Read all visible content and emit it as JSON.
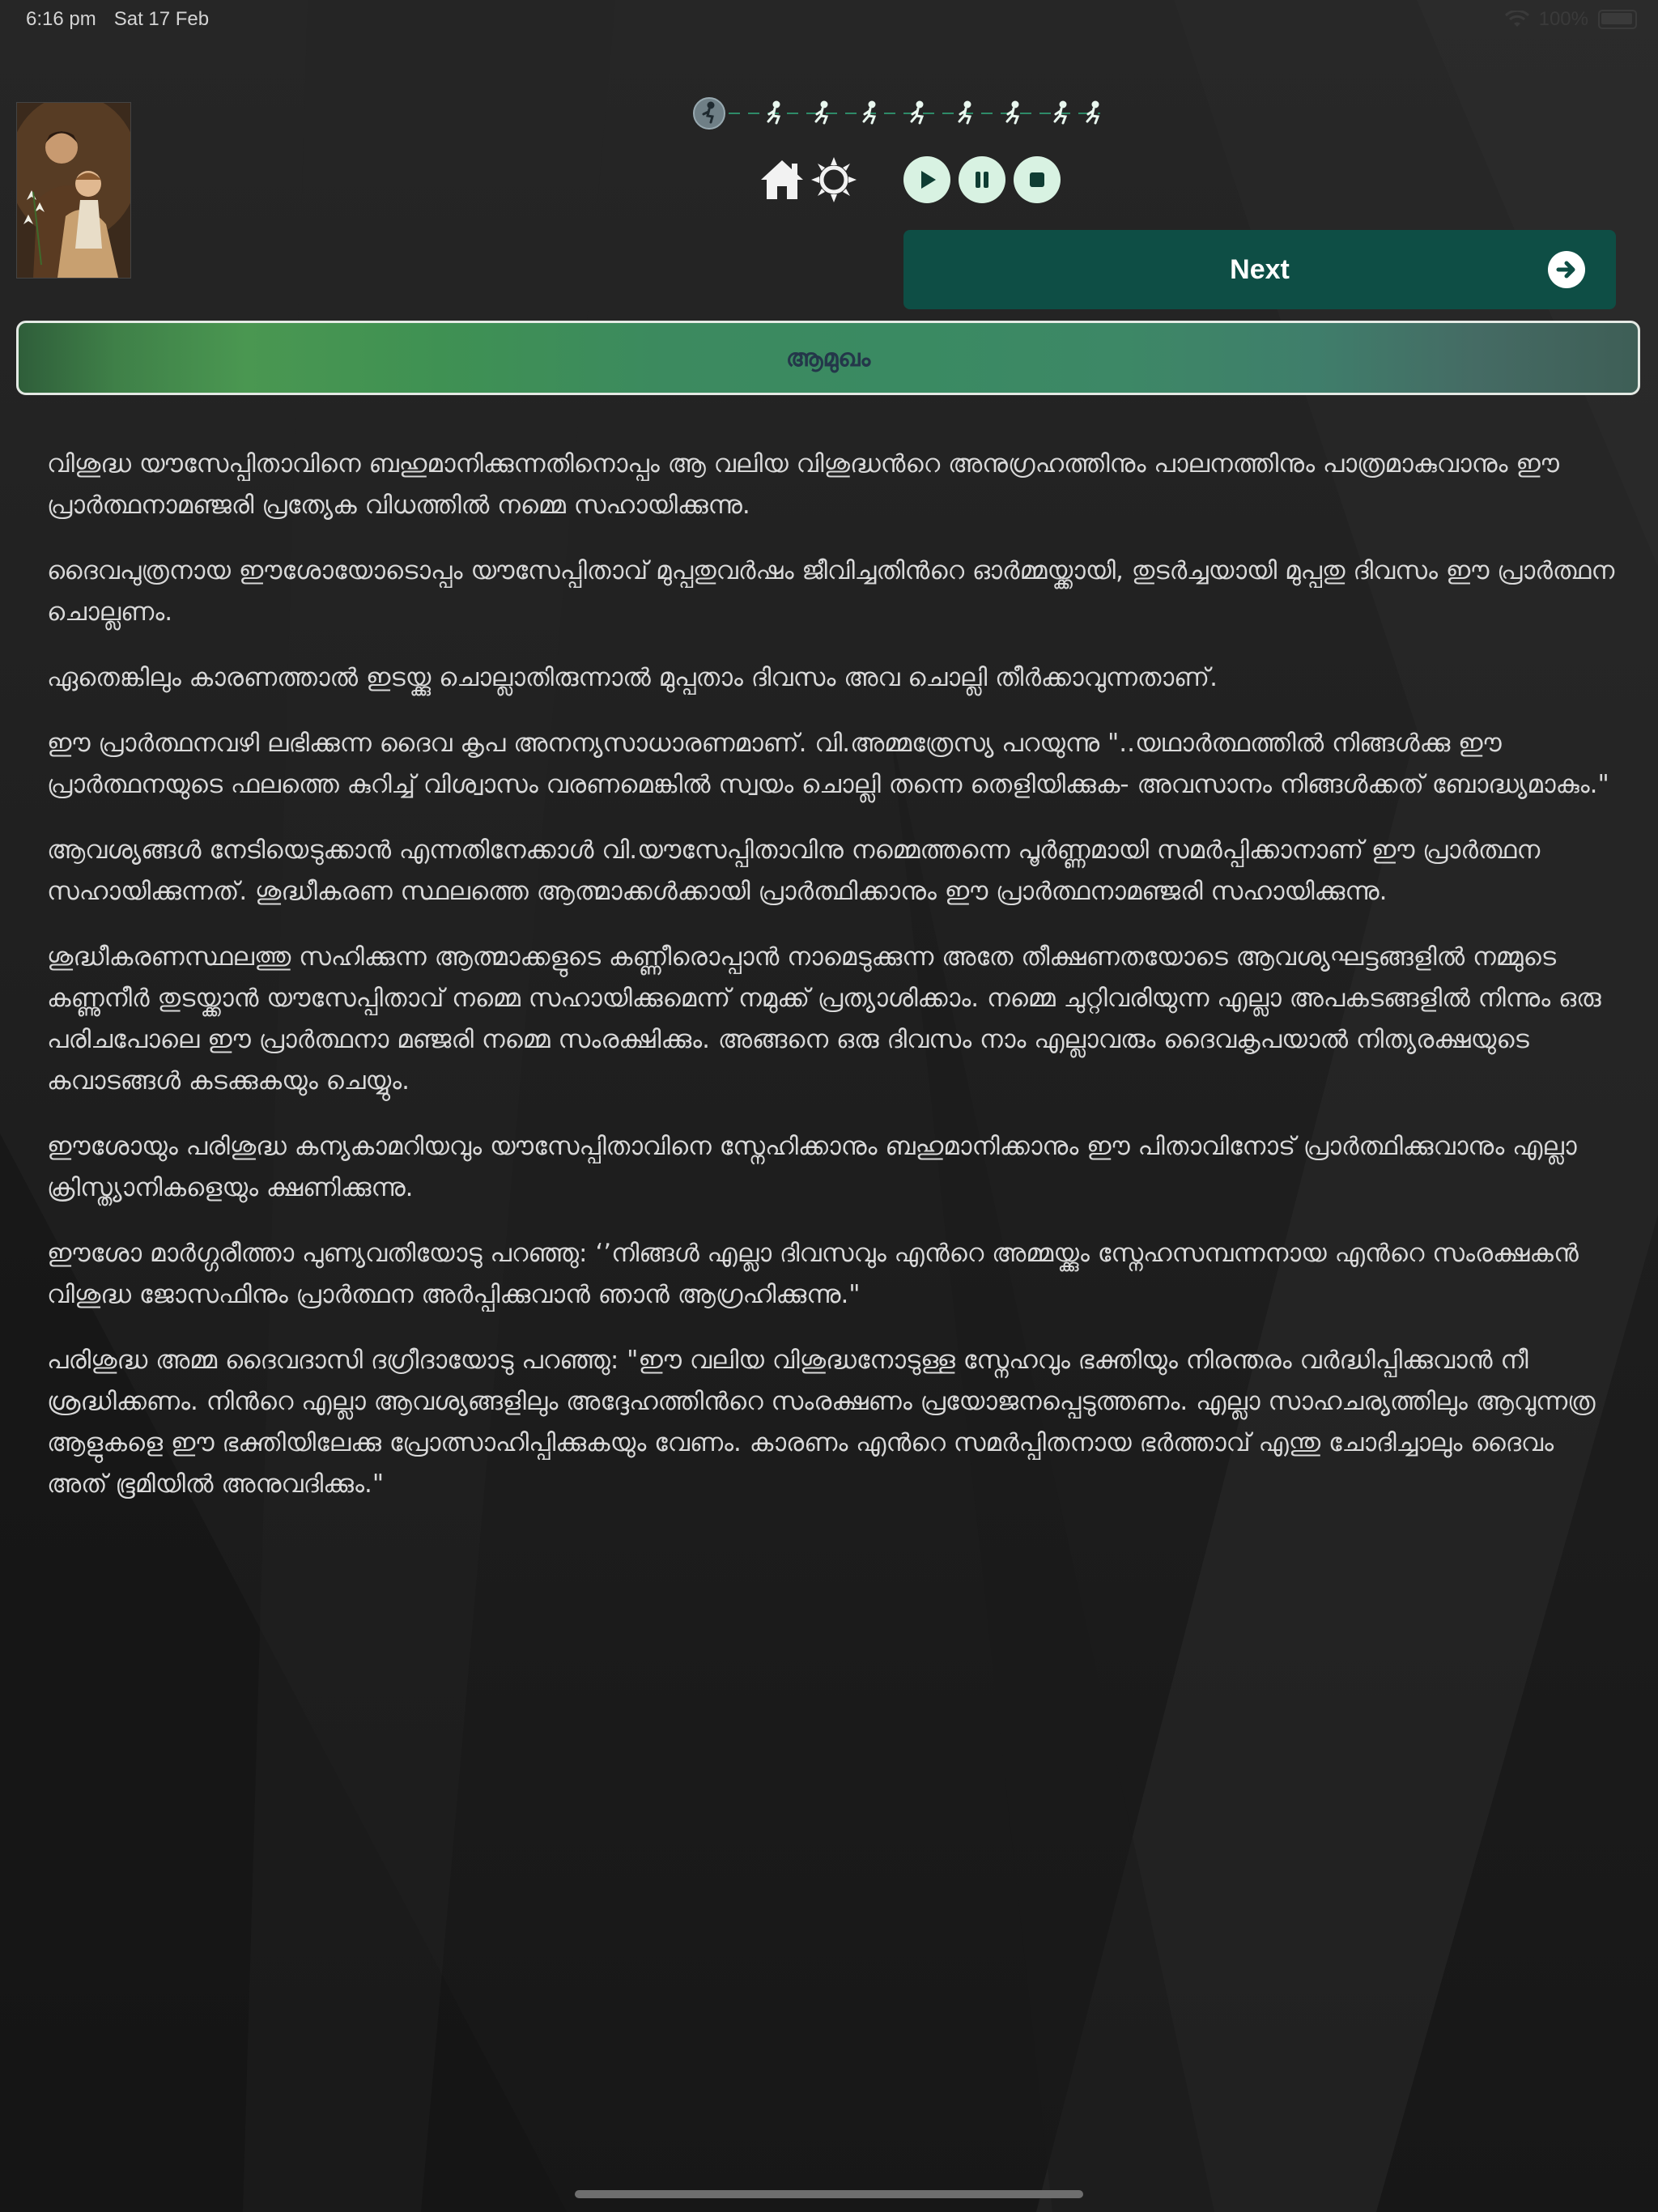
{
  "status_bar": {
    "time": "6:16 pm",
    "date": "Sat 17 Feb",
    "battery_text": "100%"
  },
  "progress": {
    "total_steps": 9,
    "current_step": 1
  },
  "toolbar": {
    "icons": [
      "home-icon",
      "brightness-icon",
      "play-icon",
      "pause-icon",
      "stop-icon"
    ]
  },
  "next_button": {
    "label": "Next",
    "color": "#0e4e45"
  },
  "section": {
    "title": "ആമുഖം"
  },
  "paragraphs": [
    "വിശുദ്ധ യൗസേപ്പിതാവിനെ ബഹുമാനിക്കുന്നതിനൊപ്പം ആ വലിയ വിശുദ്ധൻറെ അനുഗ്രഹത്തിനും പാലനത്തിനും പാത്രമാകുവാനും ഈ പ്രാർത്ഥനാമഞ്ജരി പ്രത്യേക വിധത്തിൽ നമ്മെ സഹായിക്കുന്നു.",
    "ദൈവപുത്രനായ ഈശോയോടൊപ്പം യൗസേപ്പിതാവ് മുപ്പതുവർഷം ജീവിച്ചതിൻറെ ഓർമ്മയ്ക്കായി,  തുടർച്ചയായി മുപ്പതു ദിവസം ഈ പ്രാർത്ഥന ചൊല്ലണം.",
    "ഏതെങ്കിലും കാരണത്താൽ ഇടയ്ക്കു ചൊല്ലാതിരുന്നാൽ മുപ്പതാം ദിവസം അവ ചൊല്ലി തീർക്കാവുന്നതാണ്.",
    "ഈ പ്രാർത്ഥനവഴി ലഭിക്കുന്ന ദൈവ കൃപ അനന്യസാധാരണമാണ്. വി.അമ്മത്രേസ്യ പറയുന്നു \"..യഥാർത്ഥത്തിൽ നിങ്ങൾക്കു ഈ പ്രാർത്ഥനയുടെ  ഫലത്തെ കുറിച്ച്  വിശ്വാസം വരണമെങ്കിൽ സ്വയം ചൊല്ലി തന്നെ തെളിയിക്കുക- അവസാനം നിങ്ങൾക്കത് ബോദ്ധ്യമാകും.\"",
    "ആവശ്യങ്ങൾ നേടിയെടുക്കാൻ എന്നതിനേക്കാൾ വി.യൗസേപ്പിതാവിനു  നമ്മെത്തന്നെ പൂർണ്ണമായി സമർപ്പിക്കാനാണ് ഈ പ്രാർത്ഥന സഹായിക്കുന്നത്. ശുദ്ധീകരണ സ്ഥലത്തെ ആത്മാക്കൾക്കായി പ്രാർത്ഥിക്കാനും ഈ പ്രാർത്ഥനാമഞ്ജരി സഹായിക്കുന്നു.",
    "ശുദ്ധീകരണസ്ഥലത്തു സഹിക്കുന്ന ആത്മാക്കളുടെ കണ്ണീരൊപ്പാൻ നാമെടുക്കുന്ന  അതേ തീക്ഷണതയോടെ ആവശ്യഘട്ടങ്ങളിൽ നമ്മുടെ കണ്ണുനീർ തുടയ്ക്കാൻ യൗസേപ്പിതാവ് നമ്മെ സഹായിക്കുമെന്ന് നമുക്ക് പ്രത്യാശിക്കാം. നമ്മെ ചുറ്റിവരിയുന്ന എല്ലാ അപകടങ്ങളിൽ നിന്നും ഒരു പരിചപോലെ ഈ പ്രാർത്ഥനാ മഞ്ജരി നമ്മെ സംരക്ഷിക്കും. അങ്ങനെ ഒരു ദിവസം നാം എല്ലാവരും ദൈവകൃപയാൽ നിത്യരക്ഷയുടെ കവാടങ്ങൾ കടക്കുകയും ചെയ്യും.",
    "ഈശോയും പരിശുദ്ധ കന്യകാമറിയവും യൗസേപ്പിതാവിനെ സ്നേഹിക്കാനും ബഹുമാനിക്കാനും ഈ പിതാവിനോട് പ്രാർത്ഥിക്കുവാനും എല്ലാ ക്രിസ്ത്യാനികളെയും ക്ഷണിക്കുന്നു.",
    "ഈശോ മാർഗ്ഗരീത്താ പുണ്യവതിയോടു പറഞ്ഞു: ‘’നിങ്ങൾ എല്ലാ ദിവസവും എൻറെ അമ്മയ്ക്കും സ്നേഹസമ്പന്നനായ എൻറെ സംരക്ഷകൻ വിശുദ്ധ ജോസഫിനും പ്രാർത്ഥന അർപ്പിക്കുവാൻ ഞാൻ ആഗ്രഹിക്കുന്നു.\"",
    "പരിശുദ്ധ അമ്മ ദൈവദാസി ദഗ്രീദായോടു പറഞ്ഞു: \"ഈ വലിയ വിശുദ്ധനോടുള്ള സ്നേഹവും ഭക്തിയും നിരന്തരം വർദ്ധിപ്പിക്കുവാൻ  നീ ശ്രദ്ധിക്കണം. നിൻറെ എല്ലാ ആവശ്യങ്ങളിലും അദ്ദേഹത്തിൻറെ സംരക്ഷണം പ്രയോജനപ്പെടുത്തണം. എല്ലാ സാഹചര്യത്തിലും ആവുന്നത്ര ആളുകളെ ഈ ഭക്തിയിലേക്കു പ്രോത്സാഹിപ്പിക്കുകയും വേണം. കാരണം എൻറെ സമർപ്പിതനായ ഭർത്താവ് എന്തു ചോദിച്ചാലും ദൈവം അത് ഭൂമിയിൽ അനുവദിക്കും.\""
  ]
}
